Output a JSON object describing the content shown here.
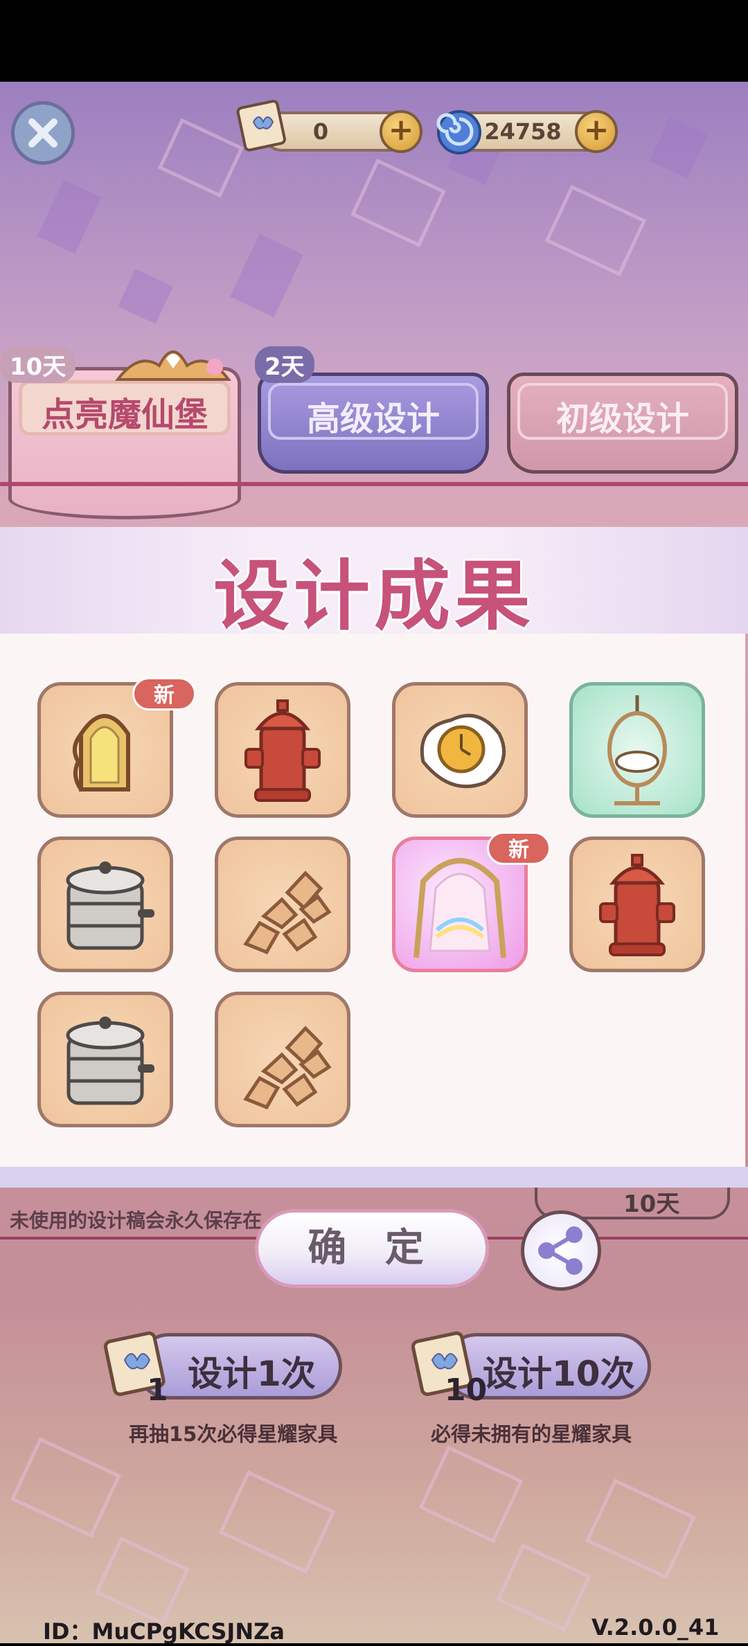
{
  "top": {
    "tickets": "0",
    "gems": "24758"
  },
  "tabs": [
    {
      "label": "点亮魔仙堡",
      "badge": "10天"
    },
    {
      "label": "高级设计",
      "badge": "2天"
    },
    {
      "label": "初级设计"
    }
  ],
  "panel": {
    "title": "设计成果",
    "new_badge": "新"
  },
  "items": [
    {
      "icon": "window-arch-icon",
      "new": true
    },
    {
      "icon": "fire-hydrant-icon",
      "new": false
    },
    {
      "icon": "fried-egg-clock-icon",
      "new": false
    },
    {
      "icon": "hanging-chair-icon",
      "new": false
    },
    {
      "icon": "steamer-pot-icon",
      "new": false
    },
    {
      "icon": "stone-path-icon",
      "new": false
    },
    {
      "icon": "arch-gate-icon",
      "new": true
    },
    {
      "icon": "fire-hydrant-icon",
      "new": false
    },
    {
      "icon": "steamer-pot-icon",
      "new": false
    },
    {
      "icon": "stone-path-icon",
      "new": false
    }
  ],
  "note": "未使用的设计稿会永久保存在",
  "timer": "10天",
  "confirm_label": "确 定",
  "draw": [
    {
      "label": "设计1次",
      "count": "1",
      "hint": "再抽15次必得星耀家具"
    },
    {
      "label": "设计10次",
      "count": "10",
      "hint": "必得未拥有的星耀家具"
    }
  ],
  "footer": {
    "id": "ID：MuCPgKCSJNZa",
    "version": "V.2.0.0_41"
  },
  "colors": {
    "accent": "#c7527a",
    "panel_bg": "#fbf6f5",
    "tab_purple": "#7a6ca8"
  }
}
